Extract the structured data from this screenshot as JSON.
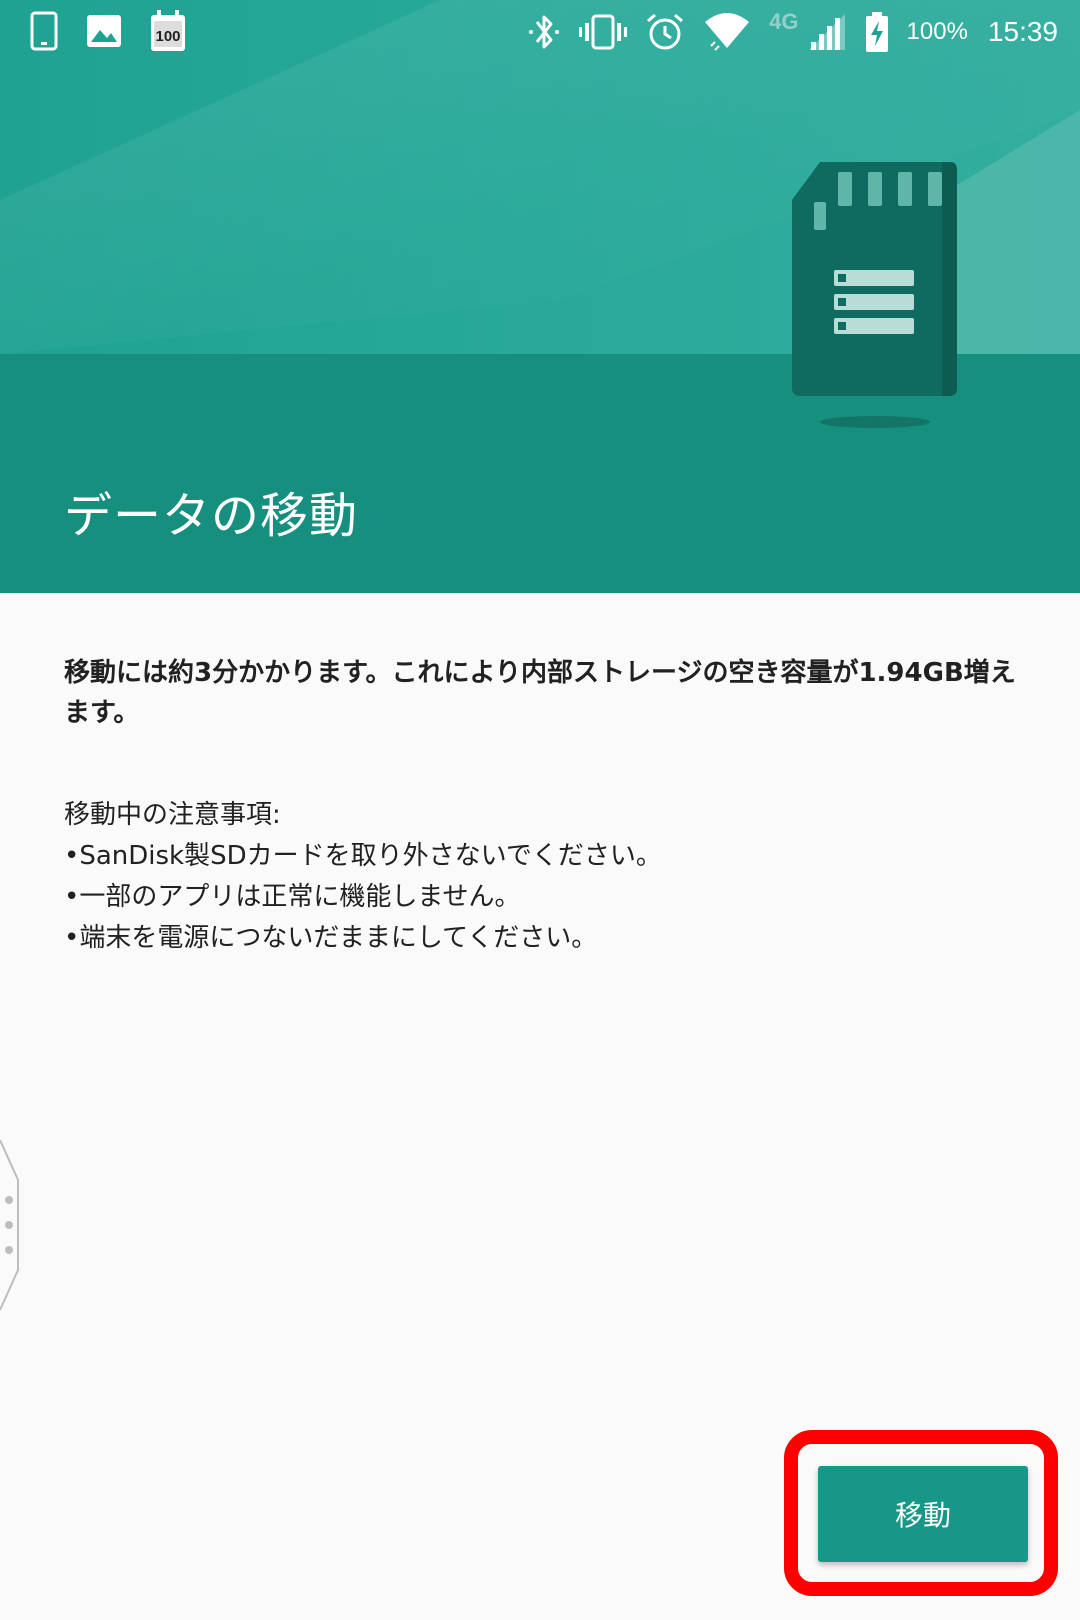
{
  "status_bar": {
    "network_type": "4G",
    "battery_percent": "100%",
    "time": "15:39",
    "notification_icons": [
      "phone-icon",
      "image-icon",
      "calendar-100-icon"
    ],
    "system_icons": [
      "bluetooth-icon",
      "vibrate-icon",
      "alarm-icon",
      "wifi-icon",
      "signal-icon",
      "battery-charging-icon"
    ]
  },
  "header": {
    "title": "データの移動",
    "illustration": "sd-card-icon",
    "background_color": "#1a9a8a"
  },
  "body": {
    "main_message": "移動には約3分かかります。これにより内部ストレージの空き容量が1.94GB増えます。",
    "notes": {
      "heading": "移動中の注意事項:",
      "items": [
        "•SanDisk製SDカードを取り外さないでください。",
        "•一部のアプリは正常に機能しません。",
        "•端末を電源につないだままにしてください。"
      ]
    }
  },
  "actions": {
    "move_label": "移動",
    "button_color": "#169787",
    "highlight_color": "#ff0000"
  }
}
